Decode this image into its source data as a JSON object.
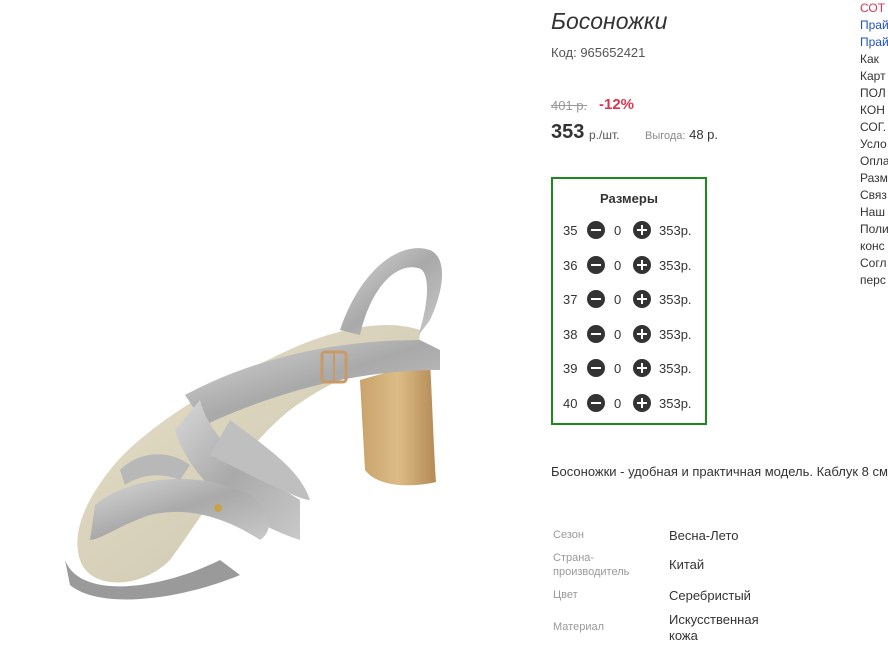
{
  "product": {
    "title": "Босоножки",
    "code": "Код: 965652421",
    "old_price": "401 р.",
    "discount": "-12%",
    "price": "353",
    "price_unit": "р./шт.",
    "profit_label": "Выгода:",
    "profit_value": "48 р."
  },
  "sizes": {
    "title": "Размеры",
    "rows": [
      {
        "size": "35",
        "qty": "0",
        "price": "353р."
      },
      {
        "size": "36",
        "qty": "0",
        "price": "353р."
      },
      {
        "size": "37",
        "qty": "0",
        "price": "353р."
      },
      {
        "size": "38",
        "qty": "0",
        "price": "353р."
      },
      {
        "size": "39",
        "qty": "0",
        "price": "353р."
      },
      {
        "size": "40",
        "qty": "0",
        "price": "353р."
      }
    ]
  },
  "description": "Босоножки - удобная и практичная модель. Каблук 8 см",
  "attributes": [
    {
      "label": "Сезон",
      "value": "Весна-Лето"
    },
    {
      "label": "Страна-производитель",
      "value": "Китай"
    },
    {
      "label": "Цвет",
      "value": "Серебристый"
    },
    {
      "label": "Материал",
      "value": "Искусственная кожа"
    }
  ],
  "side_links": [
    "СОТ",
    "Прай",
    "Прай",
    "Как",
    "Карт",
    "ПОЛ",
    "КОН",
    "СОГ.",
    "Усло",
    "Опла",
    "Разм",
    "Связ",
    "Наш",
    "Поли",
    "конс",
    "Согл",
    "перс"
  ],
  "colors": {
    "accent_green": "#1a8a1a",
    "discount_red": "#e0334e",
    "link_blue": "#1f4fcc"
  }
}
